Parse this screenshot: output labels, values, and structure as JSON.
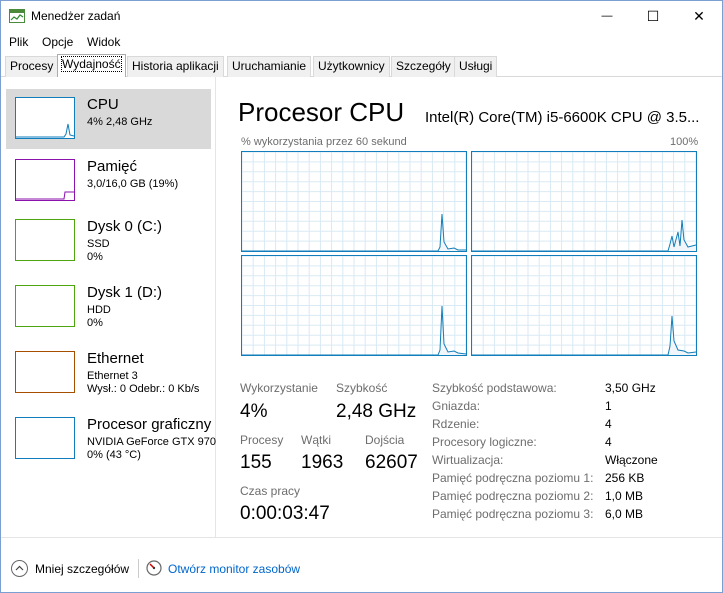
{
  "window": {
    "title": "Menedżer zadań",
    "minimize_glyph": "—",
    "maximize_glyph": "☐",
    "close_glyph": "✕"
  },
  "menu": [
    "Plik",
    "Opcje",
    "Widok"
  ],
  "tabs": [
    {
      "label": "Procesy",
      "active": false
    },
    {
      "label": "Wydajność",
      "active": true
    },
    {
      "label": "Historia aplikacji",
      "active": false
    },
    {
      "label": "Uruchamianie",
      "active": false
    },
    {
      "label": "Użytkownicy",
      "active": false
    },
    {
      "label": "Szczegóły",
      "active": false
    },
    {
      "label": "Usługi",
      "active": false
    }
  ],
  "resources": [
    {
      "name": "CPU",
      "line2": "4% 2,48 GHz",
      "line3": "",
      "color": "#117dbb",
      "selected": true
    },
    {
      "name": "Pamięć",
      "line2": "3,0/16,0 GB (19%)",
      "line3": "",
      "color": "#8b12ae",
      "selected": false
    },
    {
      "name": "Dysk 0 (C:)",
      "line2": "SSD",
      "line3": "0%",
      "color": "#4da60c",
      "selected": false
    },
    {
      "name": "Dysk 1 (D:)",
      "line2": "HDD",
      "line3": "0%",
      "color": "#4da60c",
      "selected": false
    },
    {
      "name": "Ethernet",
      "line2": "Ethernet 3",
      "line3": "Wysł.: 0 Odebr.: 0 Kb/s",
      "color": "#a74f01",
      "selected": false
    },
    {
      "name": "Procesor graficzny",
      "line2": "NVIDIA GeForce GTX 970",
      "line3": "0% (43 °C)",
      "color": "#117dbb",
      "selected": false
    }
  ],
  "cpu": {
    "title": "Procesor CPU",
    "model": "Intel(R) Core(TM) i5-6600K CPU @ 3.5...",
    "graph_caption": "% wykorzystania przez 60 sekund",
    "graph_max": "100%",
    "stats": {
      "utilization_label": "Wykorzystanie",
      "utilization_value": "4%",
      "speed_label": "Szybkość",
      "speed_value": "2,48 GHz",
      "processes_label": "Procesy",
      "processes_value": "155",
      "threads_label": "Wątki",
      "threads_value": "1963",
      "handles_label": "Dojścia",
      "handles_value": "62607",
      "uptime_label": "Czas pracy",
      "uptime_value": "0:00:03:47"
    },
    "details": [
      {
        "label": "Szybkość podstawowa:",
        "value": "3,50 GHz"
      },
      {
        "label": "Gniazda:",
        "value": "1"
      },
      {
        "label": "Rdzenie:",
        "value": "4"
      },
      {
        "label": "Procesory logiczne:",
        "value": "4"
      },
      {
        "label": "Wirtualizacja:",
        "value": "Włączone"
      },
      {
        "label": "Pamięć podręczna poziomu 1:",
        "value": "256 KB"
      },
      {
        "label": "Pamięć podręczna poziomu 2:",
        "value": "1,0 MB"
      },
      {
        "label": "Pamięć podręczna poziomu 3:",
        "value": "6,0 MB"
      }
    ]
  },
  "footer": {
    "fewer_details": "Mniej szczegółów",
    "open_monitor": "Otwórz monitor zasobów"
  },
  "colors": {
    "cpu_line": "#117dbb",
    "cpu_fill": "#f1f6fa",
    "grid": "#d9eaf4",
    "link": "#0066cc"
  }
}
